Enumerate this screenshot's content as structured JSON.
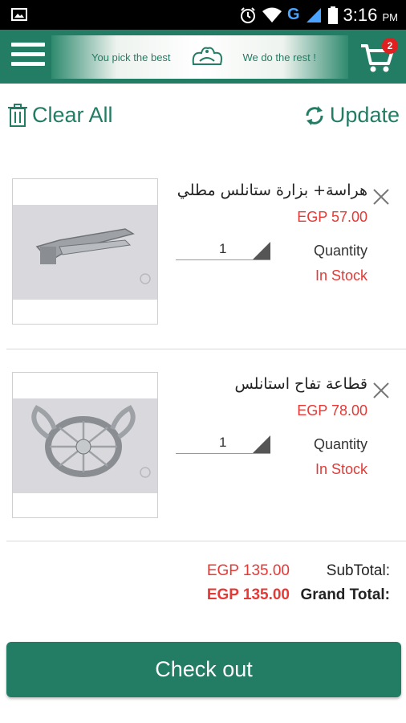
{
  "status_bar": {
    "time": "3:16",
    "ampm": "PM",
    "network": "G"
  },
  "header": {
    "tagline_left": "You pick the best",
    "tagline_right": "We do the rest !",
    "cart_count": "2",
    "accent": "#237c64"
  },
  "actions": {
    "clear_all": "Clear All",
    "update": "Update"
  },
  "items": [
    {
      "name": "هراسة+ بزارة ستانلس مطلي",
      "price": "EGP 57.00",
      "quantity": "1",
      "quantity_label": "Quantity",
      "stock": "In Stock"
    },
    {
      "name": "قطاعة تفاح استانلس",
      "price": "EGP 78.00",
      "quantity": "1",
      "quantity_label": "Quantity",
      "stock": "In Stock"
    }
  ],
  "totals": {
    "subtotal_value": "EGP 135.00",
    "subtotal_label": "SubTotal:",
    "grand_value": "EGP 135.00",
    "grand_label": "Grand Total:"
  },
  "checkout_label": "Check out",
  "colors": {
    "primary": "#237c64",
    "price": "#e53935"
  }
}
